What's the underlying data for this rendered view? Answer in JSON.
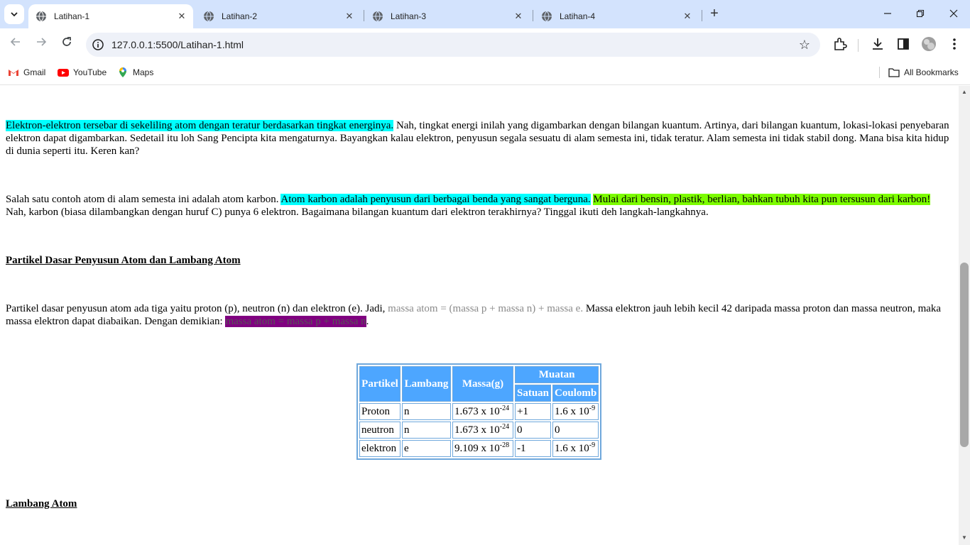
{
  "browser": {
    "tabs": [
      {
        "title": "Latihan-1",
        "active": true
      },
      {
        "title": "Latihan-2",
        "active": false
      },
      {
        "title": "Latihan-3",
        "active": false
      },
      {
        "title": "Latihan-4",
        "active": false
      }
    ],
    "address": {
      "url": "127.0.0.1:5500/Latihan-1.html"
    },
    "bookmarks": [
      {
        "label": "Gmail",
        "icon": "gmail-icon"
      },
      {
        "label": "YouTube",
        "icon": "youtube-icon"
      },
      {
        "label": "Maps",
        "icon": "maps-icon"
      }
    ],
    "all_bookmarks_label": "All Bookmarks"
  },
  "content": {
    "para1": {
      "highlight": "Elektron-elektron tersebar di sekeliling atom dengan teratur berdasarkan tingkat energinya.",
      "rest": " Nah, tingkat energi inilah yang digambarkan dengan bilangan kuantum. Artinya, dari bilangan kuantum, lokasi-lokasi penyebaran elektron dapat digambarkan. Sedetail itu loh Sang Pencipta kita mengaturnya. Bayangkan kalau elektron, penyusun segala sesuatu di alam semesta ini, tidak teratur. Alam semesta ini tidak stabil dong. Mana bisa kita hidup di dunia seperti itu. Keren kan?"
    },
    "para2": {
      "start": "Salah satu contoh atom di alam semesta ini adalah atom karbon. ",
      "highlight_cyan": "Atom karbon adalah penyusun dari berbagai benda yang sangat berguna.",
      "space": " ",
      "highlight_green": "Mulai dari bensin, plastik, berlian, bahkan tubuh kita pun tersusun dari karbon!",
      "rest": " Nah, karbon (biasa dilambangkan dengan huruf C) punya 6 elektron. Bagaimana bilangan kuantum dari elektron terakhirnya? Tinggal ikuti deh langkah-langkahnya."
    },
    "heading1": "Partikel Dasar Penyusun Atom dan Lambang Atom",
    "para3": {
      "start": "Partikel dasar penyusun atom ada tiga yaitu proton (p), neutron (n) dan elektron (e). Jadi, ",
      "gray": "massa atom = (massa p + massa n) + massa e.",
      "middle": " Massa elektron jauh lebih kecil 42 daripada massa proton dan massa neutron, maka massa elektron dapat diabaikan. Dengan demikian: ",
      "purple": "massa atom = massa p + massa n",
      "end": "."
    },
    "table": {
      "headers": {
        "partikel": "Partikel",
        "lambang": "Lambang",
        "massa": "Massa(g)",
        "muatan": "Muatan",
        "satuan": "Satuan",
        "coulomb": "Coulomb"
      },
      "rows": [
        {
          "partikel": "Proton",
          "lambang": "n",
          "massa_base": "1.673 x 10",
          "massa_exp": "-24",
          "satuan": "+1",
          "coulomb_base": "1.6 x 10",
          "coulomb_exp": "-9"
        },
        {
          "partikel": "neutron",
          "lambang": "n",
          "massa_base": "1.673 x 10",
          "massa_exp": "-24",
          "satuan": "0",
          "coulomb_base": "0",
          "coulomb_exp": ""
        },
        {
          "partikel": "elektron",
          "lambang": "e",
          "massa_base": "9.109 x 10",
          "massa_exp": "-28",
          "satuan": "-1",
          "coulomb_base": "1.6 x 10",
          "coulomb_exp": "-9"
        }
      ]
    },
    "heading2": "Lambang Atom"
  }
}
